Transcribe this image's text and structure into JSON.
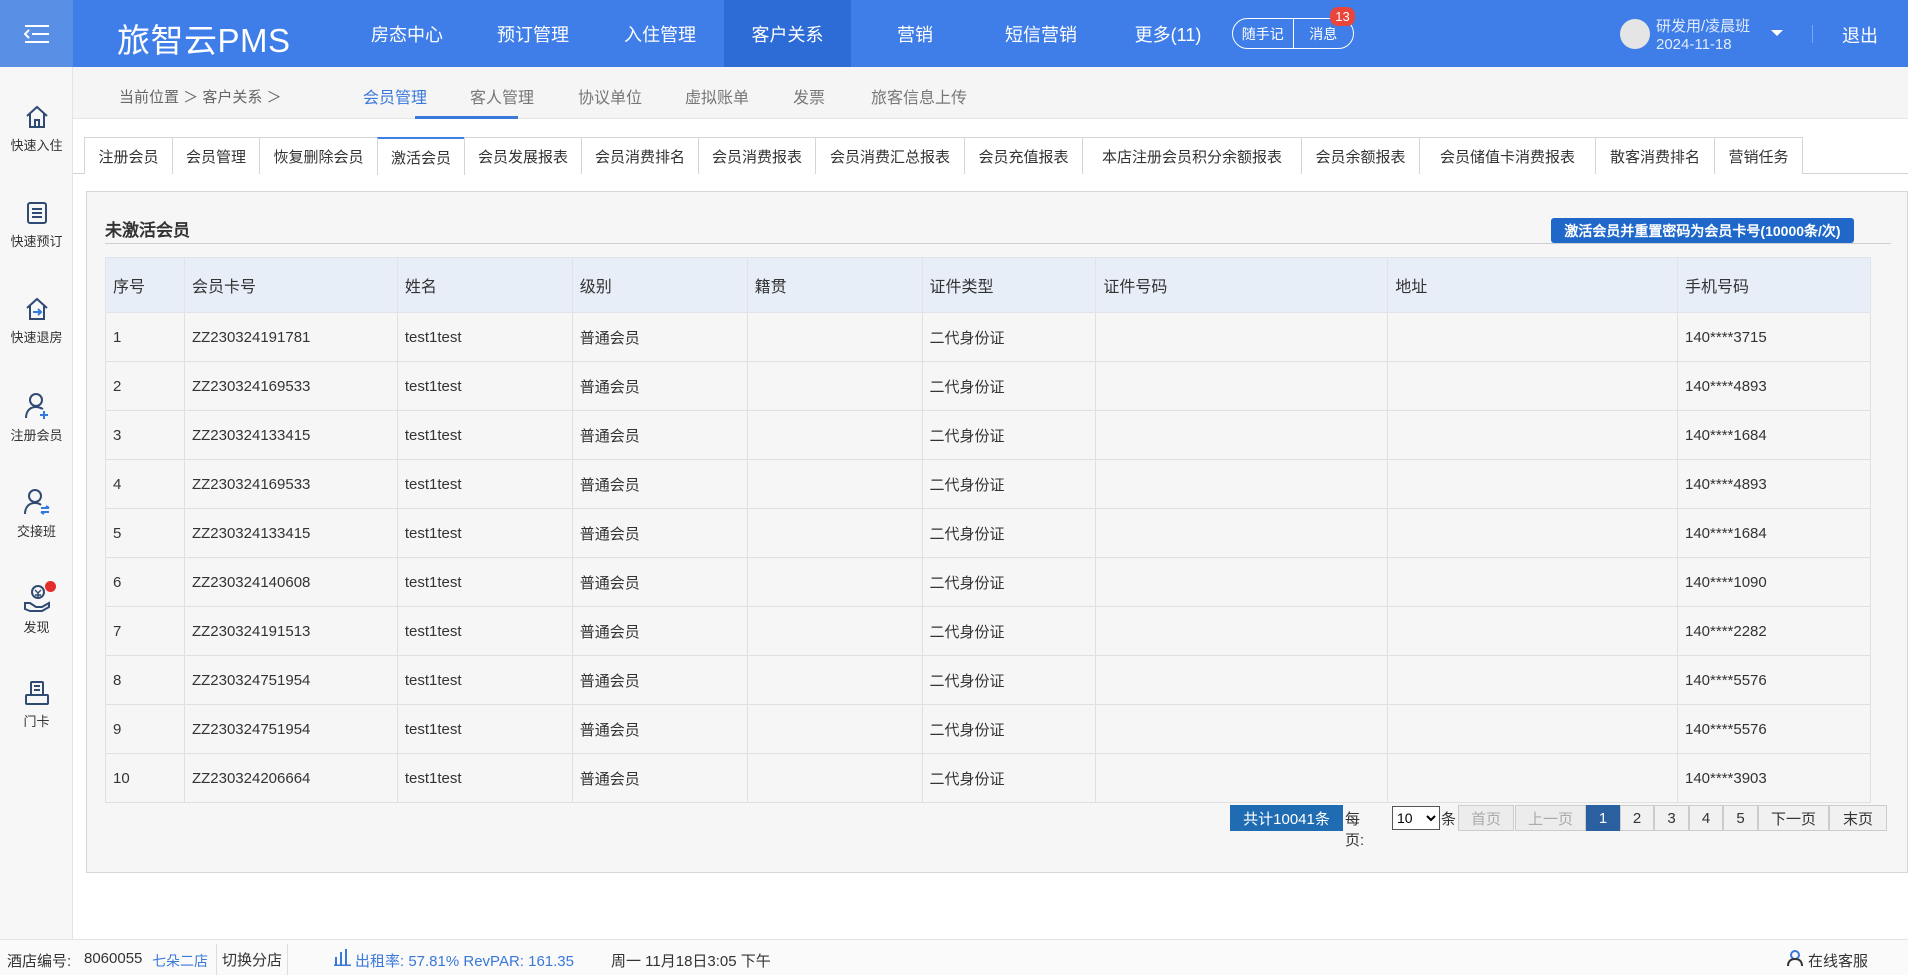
{
  "app": {
    "logo": "旅智云PMS"
  },
  "topnav": [
    {
      "label": "房态中心",
      "active": false
    },
    {
      "label": "预订管理",
      "active": false
    },
    {
      "label": "入住管理",
      "active": false
    },
    {
      "label": "客户关系",
      "active": true
    },
    {
      "label": "营销",
      "active": false
    },
    {
      "label": "短信营销",
      "active": false
    },
    {
      "label": "更多(11)",
      "active": false
    }
  ],
  "quick": {
    "notes": "随手记",
    "messages": "消息",
    "message_count": "13"
  },
  "user": {
    "name": "研发用/凌晨班",
    "date": "2024-11-18"
  },
  "logout": "退出",
  "sidebar": [
    {
      "label": "快速入住",
      "icon": "home-icon"
    },
    {
      "label": "快速预订",
      "icon": "document-icon"
    },
    {
      "label": "快速退房",
      "icon": "checkout-icon"
    },
    {
      "label": "注册会员",
      "icon": "add-user-icon"
    },
    {
      "label": "交接班",
      "icon": "shift-swap-icon"
    },
    {
      "label": "发现",
      "icon": "discover-icon"
    },
    {
      "label": "门卡",
      "icon": "door-card-icon"
    }
  ],
  "breadcrumb": {
    "text": "当前位置 ＞ 客户关系 ＞"
  },
  "category_tabs": [
    {
      "label": "会员管理",
      "active": true
    },
    {
      "label": "客人管理",
      "active": false
    },
    {
      "label": "协议单位",
      "active": false
    },
    {
      "label": "虚拟账单",
      "active": false
    },
    {
      "label": "发票",
      "active": false
    },
    {
      "label": "旅客信息上传",
      "active": false
    }
  ],
  "sub_tabs": [
    {
      "label": "注册会员",
      "active": false
    },
    {
      "label": "会员管理",
      "active": false
    },
    {
      "label": "恢复删除会员",
      "active": false
    },
    {
      "label": "激活会员",
      "active": true
    },
    {
      "label": "会员发展报表",
      "active": false
    },
    {
      "label": "会员消费排名",
      "active": false
    },
    {
      "label": "会员消费报表",
      "active": false
    },
    {
      "label": "会员消费汇总报表",
      "active": false
    },
    {
      "label": "会员充值报表",
      "active": false
    },
    {
      "label": "本店注册会员积分余额报表",
      "active": false
    },
    {
      "label": "会员余额报表",
      "active": false
    },
    {
      "label": "会员储值卡消费报表",
      "active": false
    },
    {
      "label": "散客消费排名",
      "active": false
    },
    {
      "label": "营销任务",
      "active": false
    }
  ],
  "panel": {
    "title": "未激活会员",
    "activate_button": "激活会员并重置密码为会员卡号(10000条/次)"
  },
  "table": {
    "columns": [
      "序号",
      "会员卡号",
      "姓名",
      "级别",
      "籍贯",
      "证件类型",
      "证件号码",
      "地址",
      "手机号码"
    ],
    "rows": [
      [
        "1",
        "ZZ230324191781",
        "test1test",
        "普通会员",
        "",
        "二代身份证",
        "",
        "",
        "140****3715"
      ],
      [
        "2",
        "ZZ230324169533",
        "test1test",
        "普通会员",
        "",
        "二代身份证",
        "",
        "",
        "140****4893"
      ],
      [
        "3",
        "ZZ230324133415",
        "test1test",
        "普通会员",
        "",
        "二代身份证",
        "",
        "",
        "140****1684"
      ],
      [
        "4",
        "ZZ230324169533",
        "test1test",
        "普通会员",
        "",
        "二代身份证",
        "",
        "",
        "140****4893"
      ],
      [
        "5",
        "ZZ230324133415",
        "test1test",
        "普通会员",
        "",
        "二代身份证",
        "",
        "",
        "140****1684"
      ],
      [
        "6",
        "ZZ230324140608",
        "test1test",
        "普通会员",
        "",
        "二代身份证",
        "",
        "",
        "140****1090"
      ],
      [
        "7",
        "ZZ230324191513",
        "test1test",
        "普通会员",
        "",
        "二代身份证",
        "",
        "",
        "140****2282"
      ],
      [
        "8",
        "ZZ230324751954",
        "test1test",
        "普通会员",
        "",
        "二代身份证",
        "",
        "",
        "140****5576"
      ],
      [
        "9",
        "ZZ230324751954",
        "test1test",
        "普通会员",
        "",
        "二代身份证",
        "",
        "",
        "140****5576"
      ],
      [
        "10",
        "ZZ230324206664",
        "test1test",
        "普通会员",
        "",
        "二代身份证",
        "",
        "",
        "140****3903"
      ]
    ]
  },
  "pagination": {
    "total": "共计10041条",
    "per_page_label": "每页:",
    "per_page_value": "10",
    "per_page_unit": "条",
    "first": "首页",
    "prev": "上一页",
    "pages": [
      "1",
      "2",
      "3",
      "4",
      "5"
    ],
    "current": "1",
    "next": "下一页",
    "last": "末页"
  },
  "status": {
    "hotel_label": "酒店编号:",
    "hotel_id": "8060055",
    "store": "七朵二店",
    "switch": "切换分店",
    "occupancy": "出租率:  57.81% RevPAR:  161.35",
    "datetime": "周一 11月18日3:05 下午",
    "support": "在线客服"
  },
  "colors": {
    "brand": "#3f7ee8",
    "active_nav": "#2d6bd6",
    "primary_button": "#1f68c9",
    "pager_current": "#2a5fa0",
    "badge": "#e9453a"
  }
}
